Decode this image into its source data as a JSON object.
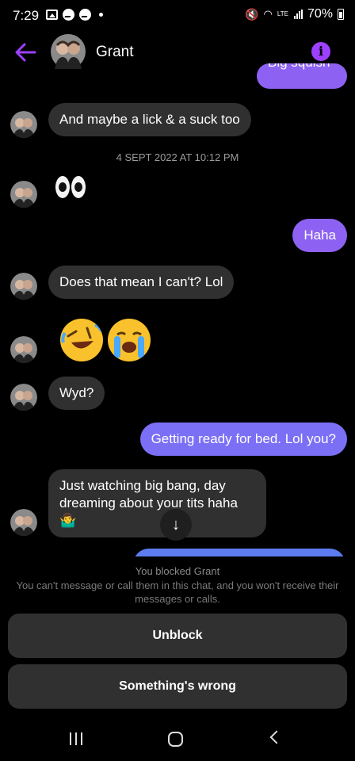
{
  "status_bar": {
    "time": "7:29",
    "battery": "70%",
    "network": "LTE"
  },
  "header": {
    "contact_name": "Grant",
    "back_icon": "arrow-left-icon",
    "info_icon": "info-icon",
    "accent_color": "#9b41ff"
  },
  "messages": {
    "cut_off_partial": "Big squish",
    "m1": "And maybe a lick & a suck too",
    "timestamp": "4 SEPT 2022 AT 10:12 PM",
    "m2_emoji": "eyes-emoji",
    "m3": "Haha",
    "m4": "Does that mean I can't? Lol",
    "m5_emoji": "rolling-on-floor-laughing and loudly-crying emoji",
    "m6": "Wyd?",
    "m7": "Getting ready for bed. Lol you?",
    "m8_line1": "Just watching big bang, day",
    "m8_line2": "dreaming about your tits haha",
    "m8_emoji": "🤷‍♂️"
  },
  "blocked": {
    "title": "You blocked Grant",
    "description": "You can't message or call them in this chat, and you won't receive their messages or calls.",
    "unblock_label": "Unblock",
    "report_label": "Something's wrong"
  },
  "colors": {
    "outgoing_bubble": "#7b6ff5",
    "incoming_bubble": "#303030"
  }
}
